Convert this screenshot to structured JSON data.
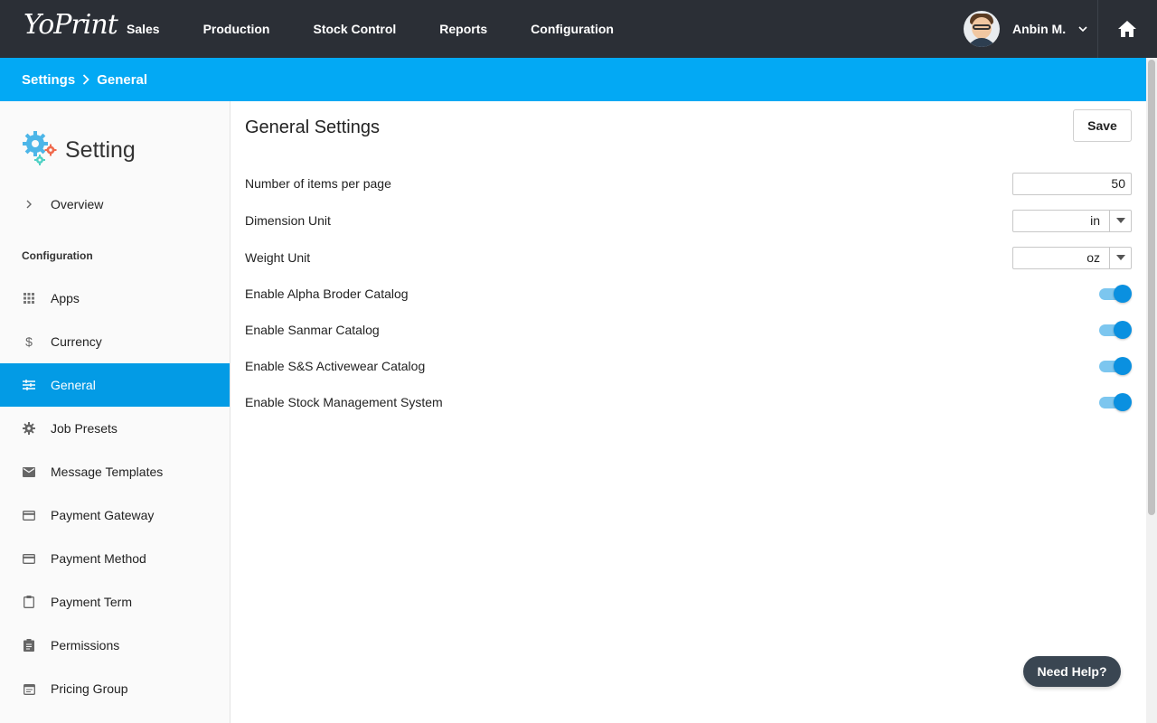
{
  "app": {
    "logo_text": "YoPrint"
  },
  "nav": {
    "items": [
      "Sales",
      "Production",
      "Stock Control",
      "Reports",
      "Configuration"
    ]
  },
  "user": {
    "name": "Anbin M."
  },
  "breadcrumb": {
    "items": [
      "Settings",
      "General"
    ]
  },
  "sidebar": {
    "title": "Setting",
    "overview_label": "Overview",
    "section_label": "Configuration",
    "items": [
      {
        "label": "Apps",
        "icon": "apps-grid-icon"
      },
      {
        "label": "Currency",
        "icon": "dollar-icon"
      },
      {
        "label": "General",
        "icon": "tune-icon",
        "active": true
      },
      {
        "label": "Job Presets",
        "icon": "gear-icon"
      },
      {
        "label": "Message Templates",
        "icon": "mail-icon"
      },
      {
        "label": "Payment Gateway",
        "icon": "credit-card-icon"
      },
      {
        "label": "Payment Method",
        "icon": "credit-card-icon"
      },
      {
        "label": "Payment Term",
        "icon": "clipboard-icon"
      },
      {
        "label": "Permissions",
        "icon": "assignment-icon"
      },
      {
        "label": "Pricing Group",
        "icon": "calendar-icon"
      }
    ]
  },
  "main": {
    "title": "General Settings",
    "save_label": "Save",
    "items_per_page": {
      "label": "Number of items per page",
      "value": "50"
    },
    "dimension_unit": {
      "label": "Dimension Unit",
      "value": "in"
    },
    "weight_unit": {
      "label": "Weight Unit",
      "value": "oz"
    },
    "toggles": [
      {
        "label": "Enable Alpha Broder Catalog",
        "on": true
      },
      {
        "label": "Enable Sanmar Catalog",
        "on": true
      },
      {
        "label": "Enable S&S Activewear Catalog",
        "on": true
      },
      {
        "label": "Enable Stock Management System",
        "on": true
      }
    ]
  },
  "help": {
    "label": "Need Help?"
  },
  "colors": {
    "topbar": "#2b2f36",
    "accent": "#03a9f4",
    "active_item": "#039be5",
    "toggle_knob": "#0a90e0",
    "toggle_track": "#7cc6ef"
  }
}
